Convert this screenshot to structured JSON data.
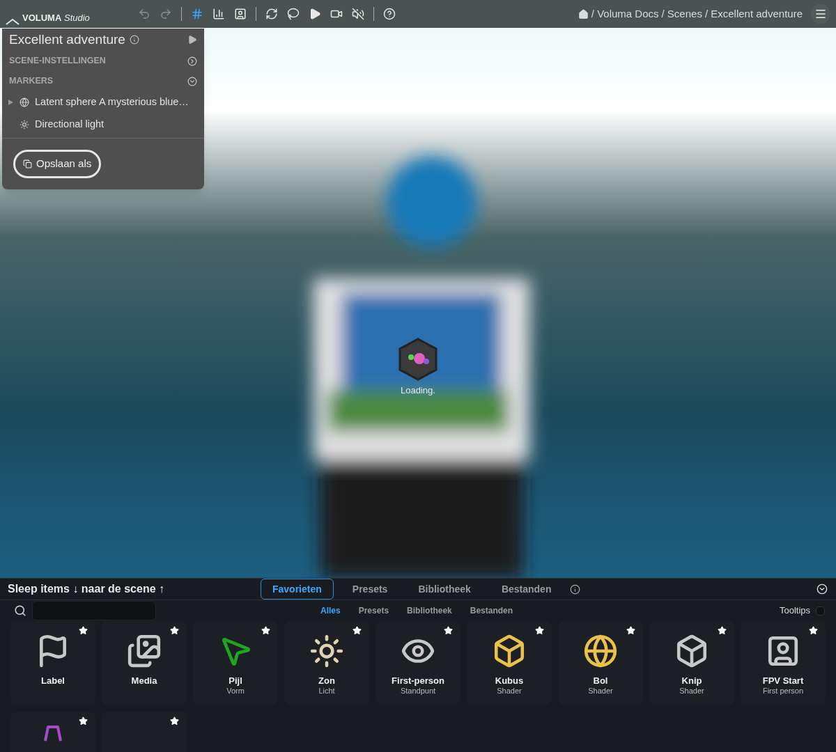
{
  "topbar": {
    "logo": {
      "brand": "VOLUMA",
      "product": "Studio"
    },
    "tools": [
      {
        "kind": "undo",
        "disabled": true,
        "selected": false
      },
      {
        "kind": "redo",
        "disabled": true,
        "selected": false
      },
      {
        "kind": "divider"
      },
      {
        "kind": "grid",
        "disabled": false,
        "selected": true
      },
      {
        "kind": "chart",
        "disabled": false,
        "selected": false
      },
      {
        "kind": "person",
        "disabled": false,
        "selected": false
      },
      {
        "kind": "divider"
      },
      {
        "kind": "refresh",
        "disabled": false,
        "selected": false
      },
      {
        "kind": "lasso",
        "disabled": false,
        "selected": false
      },
      {
        "kind": "play",
        "disabled": false,
        "selected": false
      },
      {
        "kind": "video",
        "disabled": false,
        "selected": false
      },
      {
        "kind": "mute",
        "disabled": false,
        "selected": false
      },
      {
        "kind": "divider"
      },
      {
        "kind": "help",
        "disabled": false,
        "selected": false
      }
    ],
    "breadcrumb": [
      "/ Voluma Docs",
      "/ Scenes",
      "/ Excellent adventure"
    ]
  },
  "scene_panel": {
    "title": "Excellent adventure",
    "sections": [
      {
        "label": "SCENE-INSTELLINGEN",
        "expanded": false
      },
      {
        "label": "MARKERS",
        "expanded": true
      }
    ],
    "markers": [
      {
        "kind": "sphere",
        "label": "Latent sphere A mysterious blue…",
        "has_children": true
      },
      {
        "kind": "light",
        "label": "Directional light",
        "has_children": false
      }
    ],
    "save_button": "Opslaan als"
  },
  "viewport": {
    "loading": "Loading."
  },
  "drawer": {
    "heading": "Sleep items ↓ naar de scene ↑",
    "tabs": [
      {
        "label": "Favorieten",
        "selected": true
      },
      {
        "label": "Presets",
        "selected": false
      },
      {
        "label": "Bibliotheek",
        "selected": false
      },
      {
        "label": "Bestanden",
        "selected": false
      }
    ],
    "filters": [
      {
        "label": "Alles",
        "selected": true
      },
      {
        "label": "Presets",
        "selected": false
      },
      {
        "label": "Bibliotheek",
        "selected": false
      },
      {
        "label": "Bestanden",
        "selected": false
      }
    ],
    "tooltips": {
      "label": "Tooltips",
      "checked": false
    },
    "items": [
      {
        "kind": "flag",
        "name": "Label",
        "favorite": true,
        "color": "#c8c8c8"
      },
      {
        "kind": "media",
        "name": "Media",
        "favorite": true,
        "color": "#c8c8c8"
      },
      {
        "kind": "arrow",
        "name": "Pijl",
        "sub": "Vorm",
        "favorite": true,
        "color": "#1fa51f"
      },
      {
        "kind": "sun",
        "name": "Zon",
        "sub": "Licht",
        "favorite": true,
        "color": "#e0d2b4"
      },
      {
        "kind": "eye",
        "name": "First-person",
        "sub": "Standpunt",
        "favorite": true,
        "color": "#c8c8c8"
      },
      {
        "kind": "cube",
        "name": "Kubus",
        "sub": "Shader",
        "favorite": true,
        "color": "#e8c24a"
      },
      {
        "kind": "globe",
        "name": "Bol",
        "sub": "Shader",
        "favorite": true,
        "color": "#e8c24a"
      },
      {
        "kind": "cube",
        "name": "Knip",
        "sub": "Shader",
        "favorite": true,
        "color": "#c8c8c8"
      },
      {
        "kind": "person",
        "name": "FPV Start",
        "sub": "First person",
        "favorite": true,
        "color": "#c8c8c8"
      },
      {
        "kind": "lamp",
        "favorite": true,
        "color": "#a54cc8"
      },
      {
        "kind": "blank",
        "favorite": true
      }
    ]
  }
}
